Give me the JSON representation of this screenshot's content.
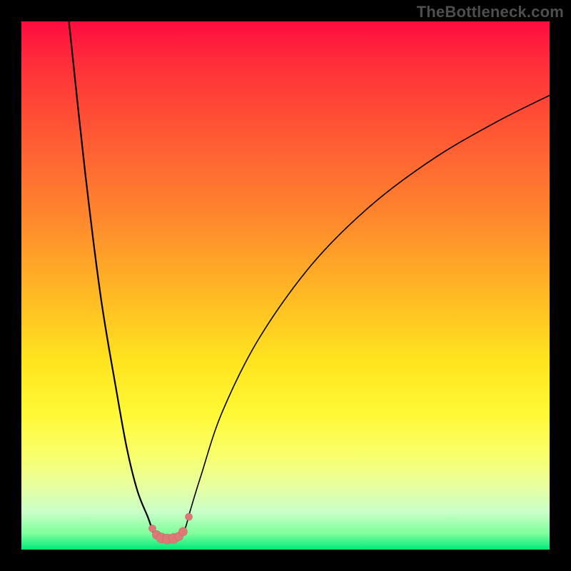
{
  "watermark": "TheBottleneck.com",
  "colors": {
    "frame": "#000000",
    "curve_stroke": "#000000",
    "marker_fill": "#dd7a78",
    "marker_stroke": "#c66763"
  },
  "chart_data": {
    "type": "line",
    "title": "",
    "xlabel": "",
    "ylabel": "",
    "xlim": [
      0,
      100
    ],
    "ylim": [
      0,
      100
    ],
    "series": [
      {
        "name": "left-arm",
        "x": [
          9,
          12,
          15,
          18,
          20,
          22,
          24,
          25,
          26
        ],
        "y": [
          100,
          72,
          48,
          30,
          19,
          11,
          6,
          3.2,
          2.2
        ]
      },
      {
        "name": "valley-floor",
        "x": [
          26,
          27,
          28,
          29,
          30
        ],
        "y": [
          2.2,
          2.0,
          2.0,
          2.1,
          2.4
        ]
      },
      {
        "name": "right-arm",
        "x": [
          30,
          31,
          32,
          34,
          38,
          45,
          55,
          66,
          78,
          90,
          100
        ],
        "y": [
          2.4,
          4.0,
          7.5,
          14,
          26,
          40,
          54,
          65,
          74,
          81,
          86
        ]
      }
    ],
    "markers": {
      "name": "highlight-dots",
      "points": [
        {
          "x": 24.8,
          "y": 4.0,
          "r": 5
        },
        {
          "x": 25.6,
          "y": 2.8,
          "r": 6
        },
        {
          "x": 26.5,
          "y": 2.2,
          "r": 7
        },
        {
          "x": 27.6,
          "y": 2.0,
          "r": 7
        },
        {
          "x": 28.8,
          "y": 2.1,
          "r": 7
        },
        {
          "x": 29.8,
          "y": 2.5,
          "r": 6
        },
        {
          "x": 30.6,
          "y": 3.4,
          "r": 6
        },
        {
          "x": 31.7,
          "y": 6.2,
          "r": 5
        }
      ]
    }
  }
}
